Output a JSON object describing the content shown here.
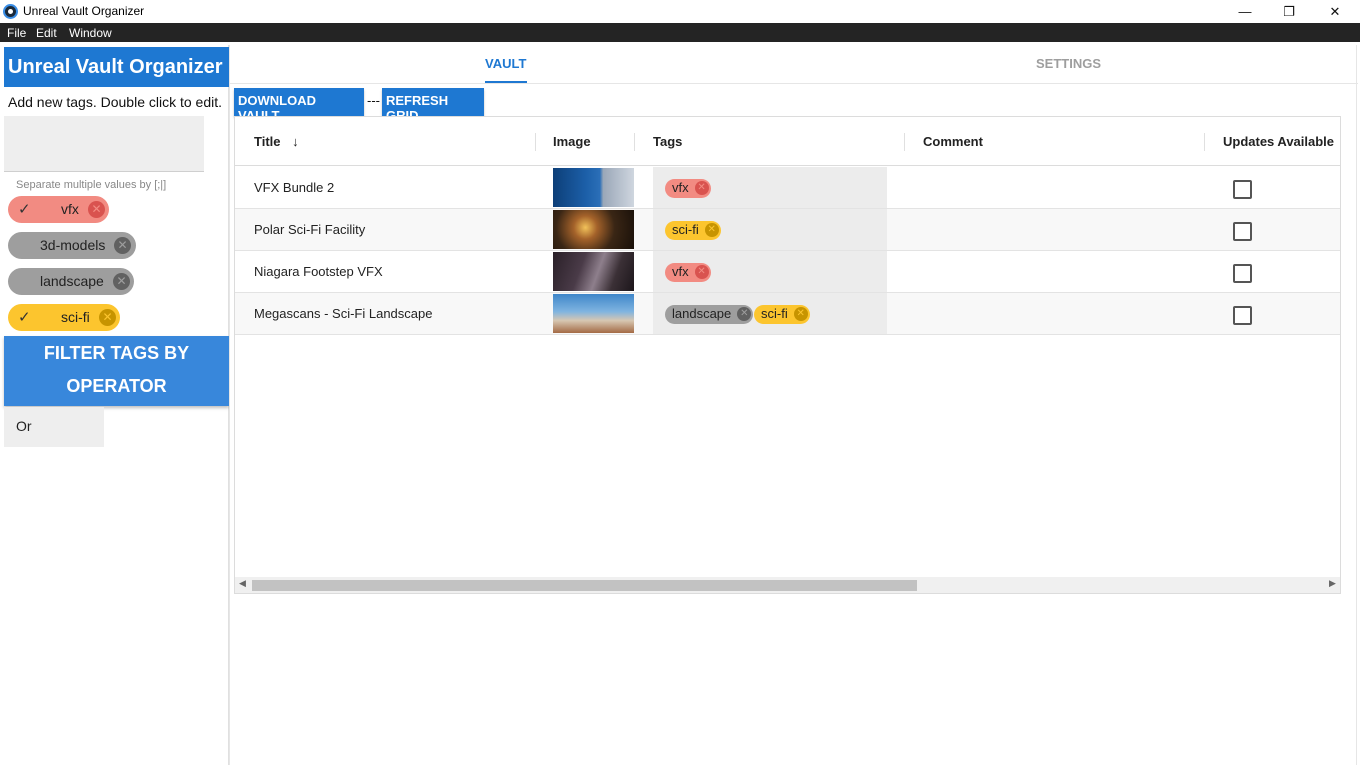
{
  "window": {
    "title": "Unreal Vault Organizer",
    "controls": {
      "minimize": "—",
      "maximize": "❐",
      "close": "✕"
    }
  },
  "menu": [
    "File",
    "Edit",
    "Window"
  ],
  "sidebar": {
    "header": "Unreal Vault Organizer",
    "hint": "Add new tags. Double click to edit.",
    "separator_hint": "Separate multiple values by [;|]",
    "tags": [
      {
        "label": "vfx",
        "selected": true,
        "color": "#f28b82"
      },
      {
        "label": "3d-models",
        "selected": false,
        "color": "#9e9e9e"
      },
      {
        "label": "landscape",
        "selected": false,
        "color": "#9e9e9e"
      },
      {
        "label": "sci-fi",
        "selected": true,
        "color": "#fcc52e"
      }
    ],
    "filter_button": "FILTER TAGS BY OPERATOR",
    "operator_value": "Or"
  },
  "tabs": [
    {
      "label": "VAULT",
      "active": true
    },
    {
      "label": "SETTINGS",
      "active": false
    }
  ],
  "toolbar": {
    "download_label": "DOWNLOAD VAULT",
    "separator": "---",
    "refresh_label": "REFRESH GRID"
  },
  "grid": {
    "columns": [
      "Title",
      "Image",
      "Tags",
      "Comment",
      "Updates Available"
    ],
    "sort_icon": "arrow-down-icon",
    "rows": [
      {
        "title": "VFX Bundle 2",
        "tags": [
          {
            "label": "vfx",
            "color": "#f28b82"
          }
        ],
        "comment": "",
        "updates": false
      },
      {
        "title": "Polar Sci-Fi Facility",
        "tags": [
          {
            "label": "sci-fi",
            "color": "#fcc52e"
          }
        ],
        "comment": "",
        "updates": false
      },
      {
        "title": "Niagara Footstep VFX",
        "tags": [
          {
            "label": "vfx",
            "color": "#f28b82"
          }
        ],
        "comment": "",
        "updates": false
      },
      {
        "title": "Megascans - Sci-Fi Landscape",
        "tags": [
          {
            "label": "landscape",
            "color": "#9e9e9e"
          },
          {
            "label": "sci-fi",
            "color": "#fcc52e"
          }
        ],
        "comment": "",
        "updates": false
      }
    ]
  },
  "colors": {
    "accent": "#1e78d2",
    "filter_button": "#3887db",
    "menubar": "#242424"
  }
}
